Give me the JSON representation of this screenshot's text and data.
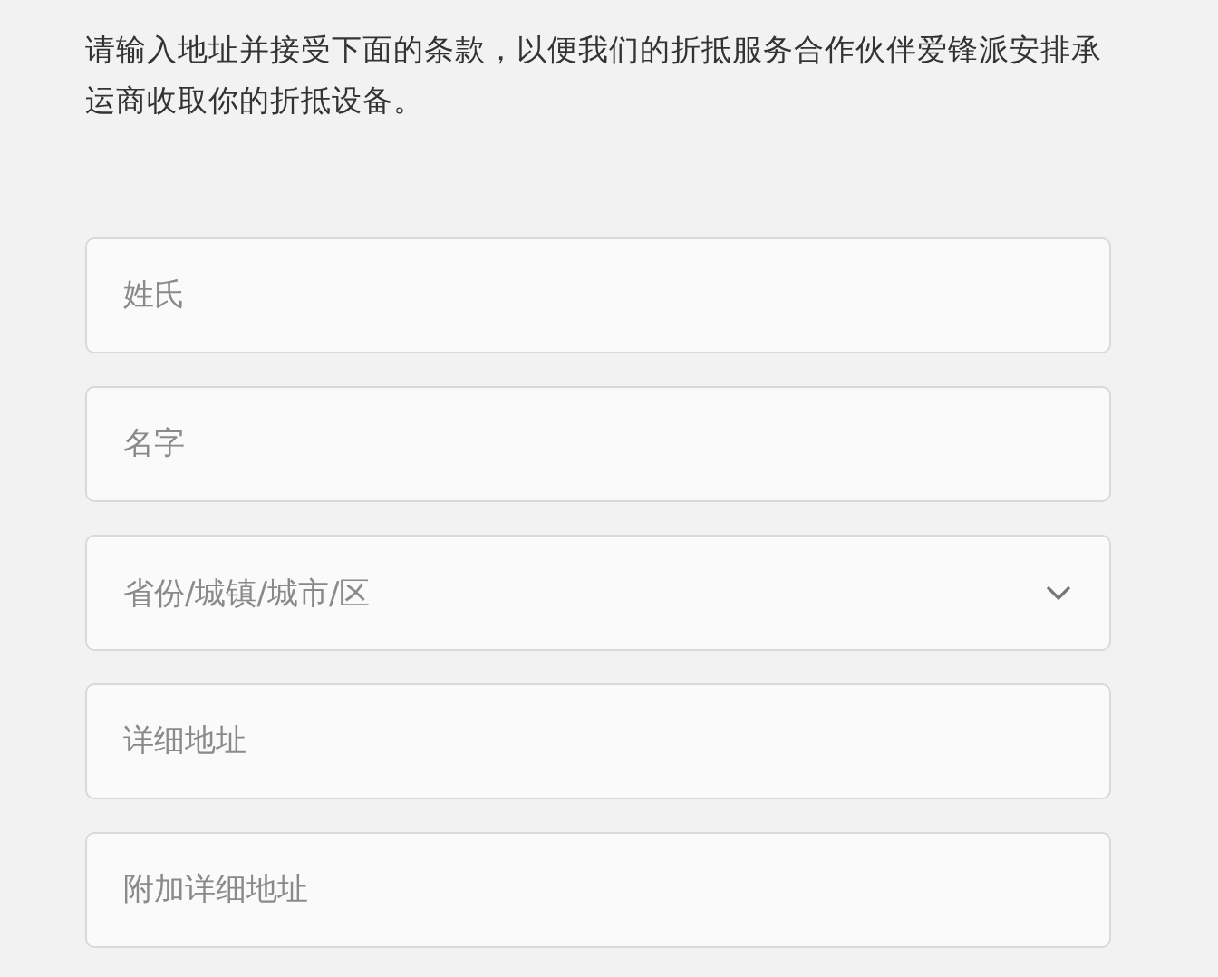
{
  "intro": "请输入地址并接受下面的条款，以便我们的折抵服务合作伙伴爱锋派安排承运商收取你的折抵设备。",
  "fields": [
    {
      "kind": "text",
      "placeholder": "姓氏"
    },
    {
      "kind": "text",
      "placeholder": "名字"
    },
    {
      "kind": "select",
      "placeholder": "省份/城镇/城市/区"
    },
    {
      "kind": "text",
      "placeholder": "详细地址"
    },
    {
      "kind": "text",
      "placeholder": "附加详细地址"
    }
  ]
}
